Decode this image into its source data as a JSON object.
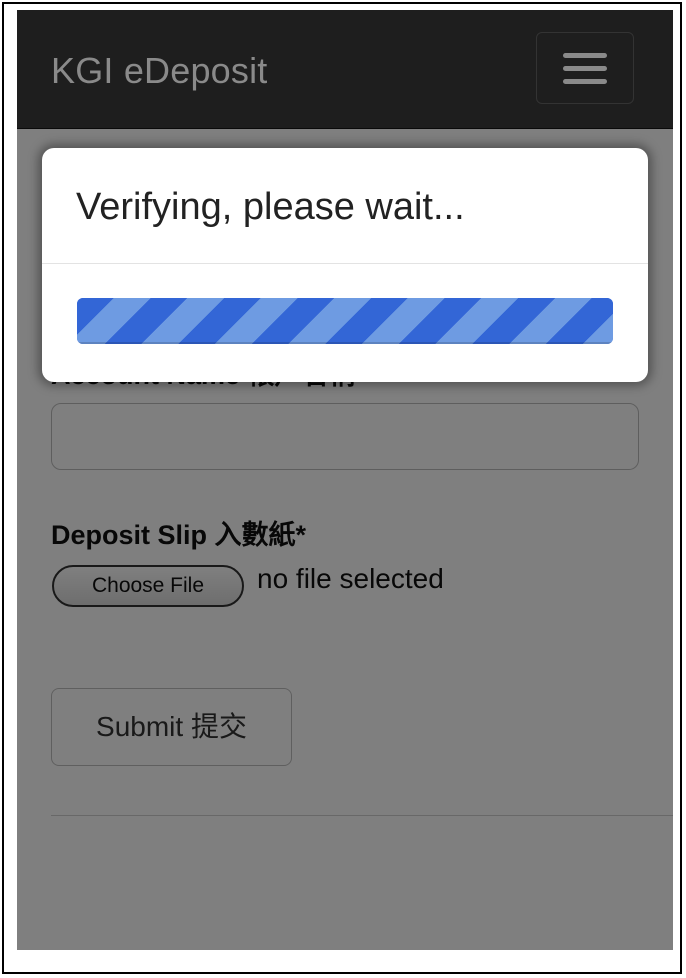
{
  "navbar": {
    "brand": "KGI eDeposit",
    "menu_icon": "hamburger-menu-icon"
  },
  "form": {
    "account_name_label": "Account Name 帳戶名稱*",
    "account_name_value": "",
    "deposit_slip_label": "Deposit Slip 入數紙*",
    "file_button_label": "Choose File",
    "file_status": "no file selected",
    "submit_label": "Submit 提交"
  },
  "modal": {
    "title": "Verifying, please wait...",
    "progress_fraction": 1.0
  },
  "colors": {
    "navbar_bg": "#1e1e1e",
    "progress_primary": "#3366d6",
    "progress_stripe": "#6e9be2"
  }
}
